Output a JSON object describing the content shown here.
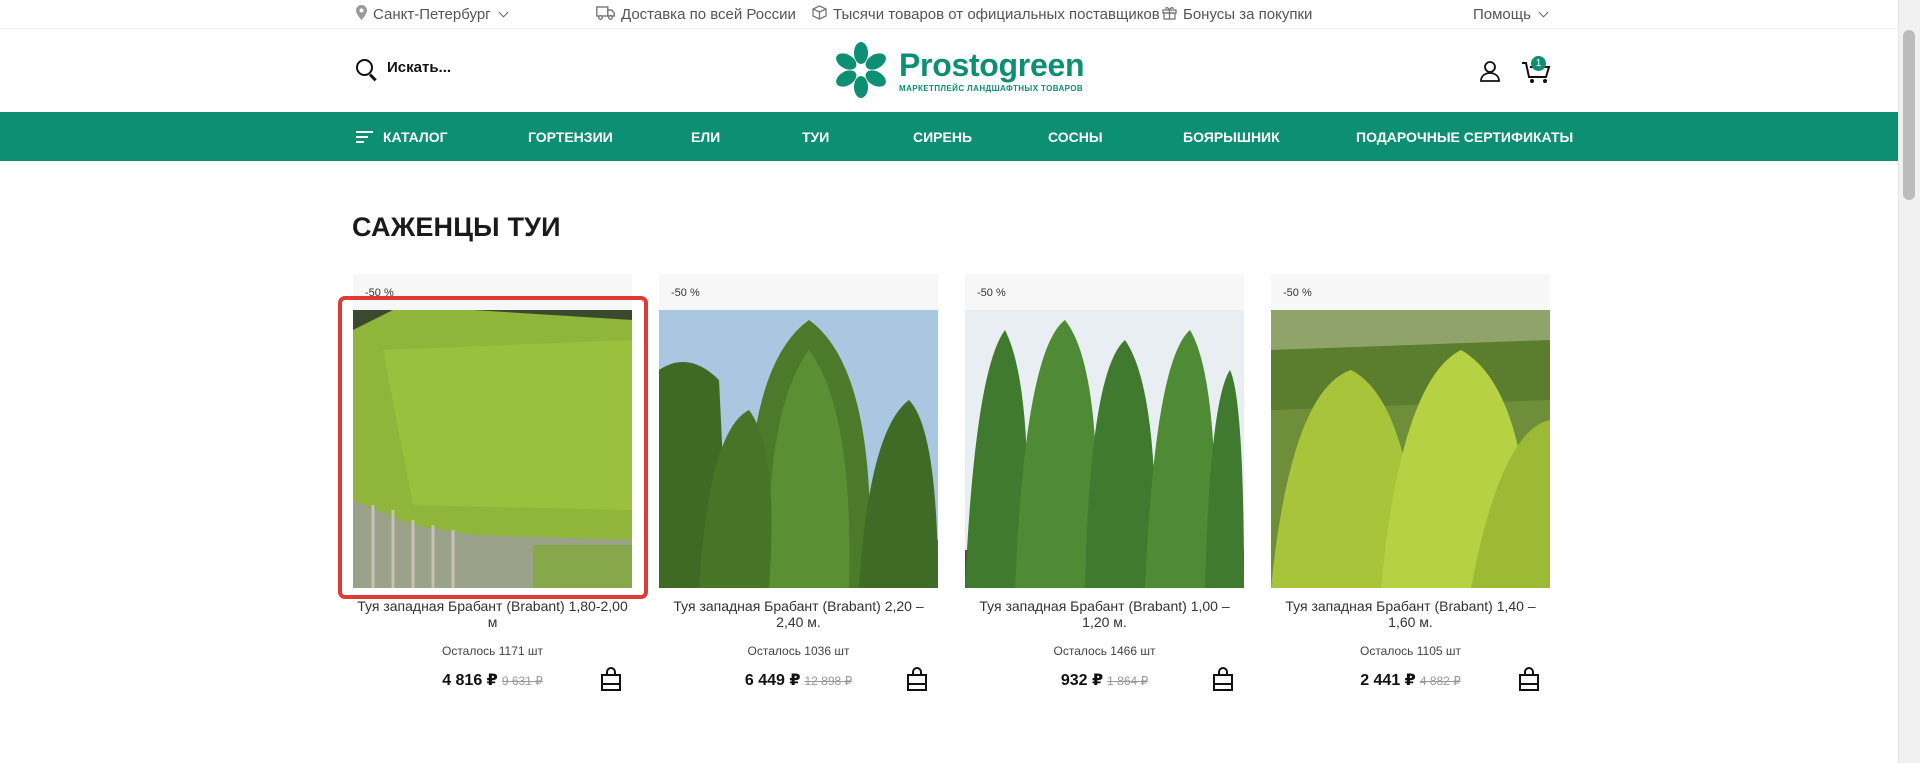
{
  "topbar": {
    "city": "Санкт-Петербург",
    "delivery": "Доставка по всей России",
    "suppliers": "Тысячи товаров от официальных поставщиков",
    "bonuses": "Бонусы за покупки",
    "help": "Помощь"
  },
  "header": {
    "search_label": "Искать...",
    "brand_name": "Prostogreen",
    "brand_tagline": "МАРКЕТПЛЕЙС ЛАНДШАФТНЫХ ТОВАРОВ",
    "cart_count": "1"
  },
  "nav": {
    "items": [
      {
        "label": "КАТАЛОГ"
      },
      {
        "label": "ГОРТЕНЗИИ"
      },
      {
        "label": "ЕЛИ"
      },
      {
        "label": "ТУИ"
      },
      {
        "label": "СИРЕНЬ"
      },
      {
        "label": "СОСНЫ"
      },
      {
        "label": "БОЯРЫШНИК"
      },
      {
        "label": "ПОДАРОЧНЫЕ СЕРТИФИКАТЫ"
      }
    ]
  },
  "section": {
    "title": "САЖЕНЦЫ ТУИ"
  },
  "products": [
    {
      "discount": "-50 %",
      "name": "Туя западная Брабант (Brabant) 1,80-2,00 м",
      "stock": "Осталось 1171 шт",
      "price": "4 816 ₽",
      "old_price": "9 631 ₽"
    },
    {
      "discount": "-50 %",
      "name": "Туя западная Брабант (Brabant) 2,20 – 2,40 м.",
      "stock": "Осталось 1036 шт",
      "price": "6 449 ₽",
      "old_price": "12 898 ₽"
    },
    {
      "discount": "-50 %",
      "name": "Туя западная Брабант (Brabant) 1,00 – 1,20 м.",
      "stock": "Осталось 1466 шт",
      "price": "932 ₽",
      "old_price": "1 864 ₽"
    },
    {
      "discount": "-50 %",
      "name": "Туя западная Брабант (Brabant) 1,40 – 1,60 м.",
      "stock": "Осталось 1105 шт",
      "price": "2 441 ₽",
      "old_price": "4 882 ₽"
    }
  ],
  "colors": {
    "brand_green": "#0c8f73",
    "highlight_red": "#e03a35"
  }
}
